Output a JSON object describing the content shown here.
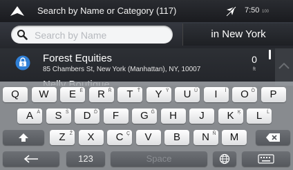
{
  "header": {
    "title": "Search by Name or Category (117)",
    "time": "7:50",
    "battery": "100"
  },
  "search": {
    "placeholder": "Search by Name",
    "value": "",
    "location_label": "in New York"
  },
  "results": [
    {
      "name": "Forest Equities",
      "address": "85 Chambers St, New York (Manhattan), NY, 10007",
      "distance": "0",
      "unit": "ft",
      "icon": "bank-icon"
    },
    {
      "name": "Nelly Boutique"
    }
  ],
  "keyboard": {
    "row1": [
      {
        "k": "Q",
        "s": ""
      },
      {
        "k": "W",
        "s": ""
      },
      {
        "k": "E",
        "s": "É"
      },
      {
        "k": "R",
        "s": "Ř"
      },
      {
        "k": "T",
        "s": "Ť"
      },
      {
        "k": "Y",
        "s": "Ÿ"
      },
      {
        "k": "U",
        "s": "Ü"
      },
      {
        "k": "I",
        "s": "Í"
      },
      {
        "k": "O",
        "s": "Ö"
      },
      {
        "k": "P",
        "s": ""
      }
    ],
    "row2": [
      {
        "k": "A",
        "s": "Á"
      },
      {
        "k": "S",
        "s": "Š"
      },
      {
        "k": "D",
        "s": "Ď"
      },
      {
        "k": "F",
        "s": ""
      },
      {
        "k": "G",
        "s": "Ğ"
      },
      {
        "k": "H",
        "s": ""
      },
      {
        "k": "J",
        "s": ""
      },
      {
        "k": "K",
        "s": "Ķ"
      },
      {
        "k": "L",
        "s": "Ĺ"
      }
    ],
    "row3": [
      {
        "k": "Z",
        "s": "Ž"
      },
      {
        "k": "X",
        "s": ""
      },
      {
        "k": "C",
        "s": "Ç"
      },
      {
        "k": "V",
        "s": ""
      },
      {
        "k": "B",
        "s": ""
      },
      {
        "k": "N",
        "s": "Ñ"
      },
      {
        "k": "M",
        "s": ""
      }
    ],
    "numbers_label": "123",
    "space_label": "Space",
    "icons": {
      "shift": "shift-icon",
      "backspace": "backspace-icon",
      "back": "back-arrow-icon",
      "globe": "globe-icon",
      "hide": "keyboard-icon"
    }
  }
}
